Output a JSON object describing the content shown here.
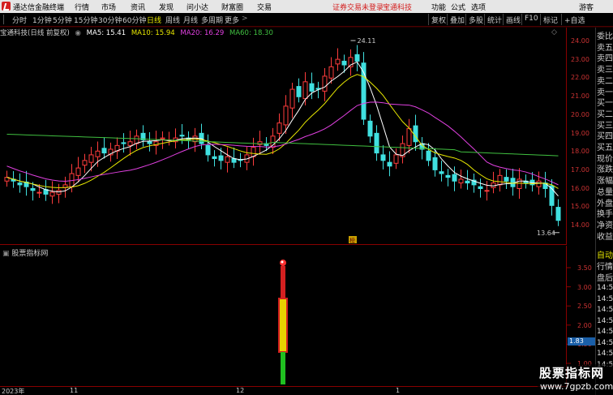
{
  "titlebar": {
    "app_title": "通达信金融终端",
    "menus": [
      "行情",
      "市场",
      "资讯",
      "发现",
      "问小达",
      "财富圈",
      "交易"
    ],
    "warning": "证券交易未登录",
    "stock": "宝通科技",
    "right_menus": [
      "功能",
      "公式",
      "选项"
    ],
    "guest": "游客"
  },
  "toolbar": {
    "periods": [
      "分时",
      "1分钟",
      "5分钟",
      "15分钟",
      "30分钟",
      "60分钟",
      "日线",
      "周线",
      "月线",
      "多周期",
      "更多"
    ],
    "active_period": "日线",
    "right_buttons": [
      "复权",
      "叠加",
      "多股",
      "统计",
      "画线",
      "F10",
      "标记",
      "+自选"
    ]
  },
  "main_chart": {
    "stock_label": "宝通科技(日线 前复权)",
    "ma": [
      {
        "label": "MA5: 15.41",
        "color": "#ffffff"
      },
      {
        "label": "MA10: 15.94",
        "color": "#e8e800"
      },
      {
        "label": "MA20: 16.29",
        "color": "#e040e0"
      },
      {
        "label": "MA60: 18.30",
        "color": "#40c040"
      }
    ],
    "high_label": "24.11",
    "low_label": "13.64",
    "y_ticks": [
      "24.00",
      "23.00",
      "22.00",
      "21.00",
      "20.00",
      "19.00",
      "18.00",
      "17.00",
      "16.00",
      "15.00",
      "14.00"
    ],
    "marker_label": "榜"
  },
  "indicator": {
    "name": "股票指标网",
    "y_ticks": [
      "3.50",
      "3.00",
      "2.50",
      "2.00",
      "1.50",
      "1.00"
    ],
    "value_box": "1.83"
  },
  "x_axis": [
    "2023年",
    "11",
    "12",
    "1"
  ],
  "right_column": {
    "labels": [
      "委比",
      "卖五",
      "卖四",
      "卖三",
      "卖二",
      "卖一",
      "买一",
      "买二",
      "买三",
      "买四",
      "买五",
      "现价",
      "涨跌",
      "涨幅",
      "总量",
      "外盘",
      "换手",
      "净资",
      "收益"
    ],
    "labels2": [
      "自动",
      "行情",
      "盘后"
    ],
    "times": [
      "14:5",
      "14:5",
      "14:5",
      "14:5",
      "14:5",
      "14:5",
      "14:5",
      "14:5"
    ]
  },
  "watermark": {
    "line1": "股票指标网",
    "line2": "www.7gpzb.com"
  },
  "colors": {
    "up": "#ff3c3c",
    "down": "#40e0e0",
    "ma5": "#ffffff",
    "ma10": "#e8e800",
    "ma20": "#e040e0",
    "ma60": "#40c040"
  }
}
